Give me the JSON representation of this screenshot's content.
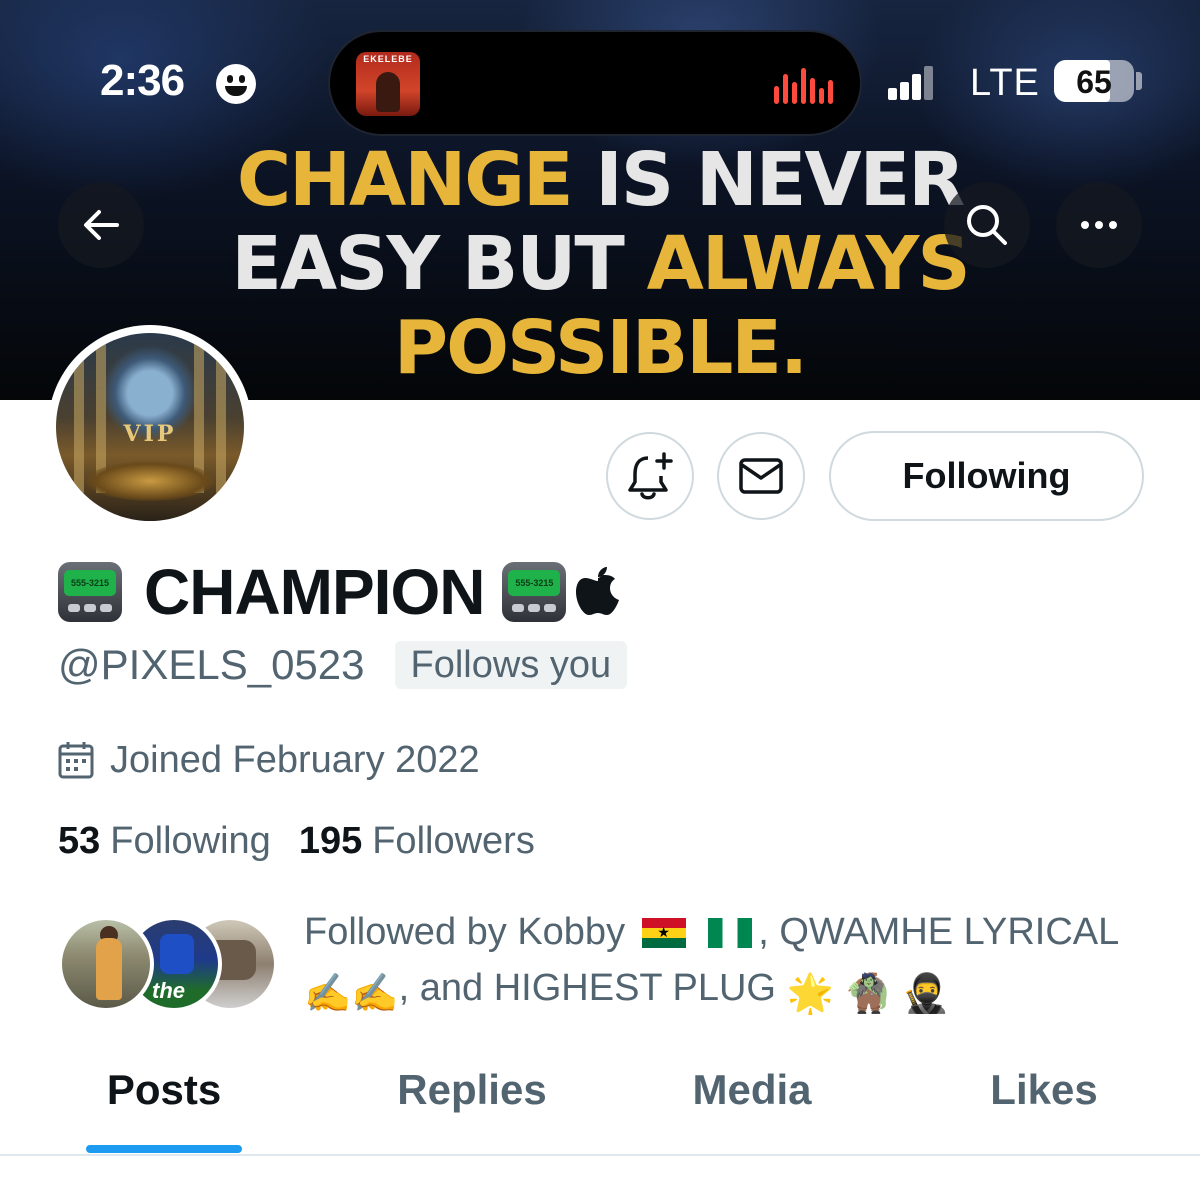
{
  "status_bar": {
    "time": "2:36",
    "now_playing_label": "EKELEBE",
    "network": "LTE",
    "battery": "65"
  },
  "banner": {
    "lines": [
      [
        {
          "text": "CHANGE",
          "color": "gold"
        },
        {
          "text": " IS NEVER",
          "color": "white"
        }
      ],
      [
        {
          "text": "EASY BUT ",
          "color": "white"
        },
        {
          "text": "ALWAYS",
          "color": "gold"
        }
      ],
      [
        {
          "text": "POSSIBLE.",
          "color": "gold"
        }
      ]
    ],
    "colors": {
      "gold": "#e6b53a",
      "white": "#e6e6e6"
    }
  },
  "avatar": {
    "text": "VIP"
  },
  "actions": {
    "notify_icon": "bell-plus-icon",
    "message_icon": "envelope-icon",
    "following_label": "Following"
  },
  "profile": {
    "display_name": "CHAMPION",
    "pager_screen_text": "555-3215",
    "handle": "@PIXELS_0523",
    "follows_you": "Follows you",
    "joined": "Joined February 2022",
    "following_count": "53",
    "following_label": "Following",
    "followers_count": "195",
    "followers_label": "Followers"
  },
  "followed_by": {
    "prefix": "Followed by Kobby",
    "part2": ", QWAMHE LYRICAL",
    "part3": ", and HIGHEST PLUG",
    "emoji_writing": "✍️",
    "emoji_star": "🌟",
    "emoji_troll": "🧌",
    "emoji_ninja": "🥷",
    "avatar_overlay_text": "the"
  },
  "tabs": [
    {
      "label": "Posts",
      "active": true
    },
    {
      "label": "Replies",
      "active": false
    },
    {
      "label": "Media",
      "active": false
    },
    {
      "label": "Likes",
      "active": false
    }
  ],
  "accent_color": "#1d9bf0"
}
